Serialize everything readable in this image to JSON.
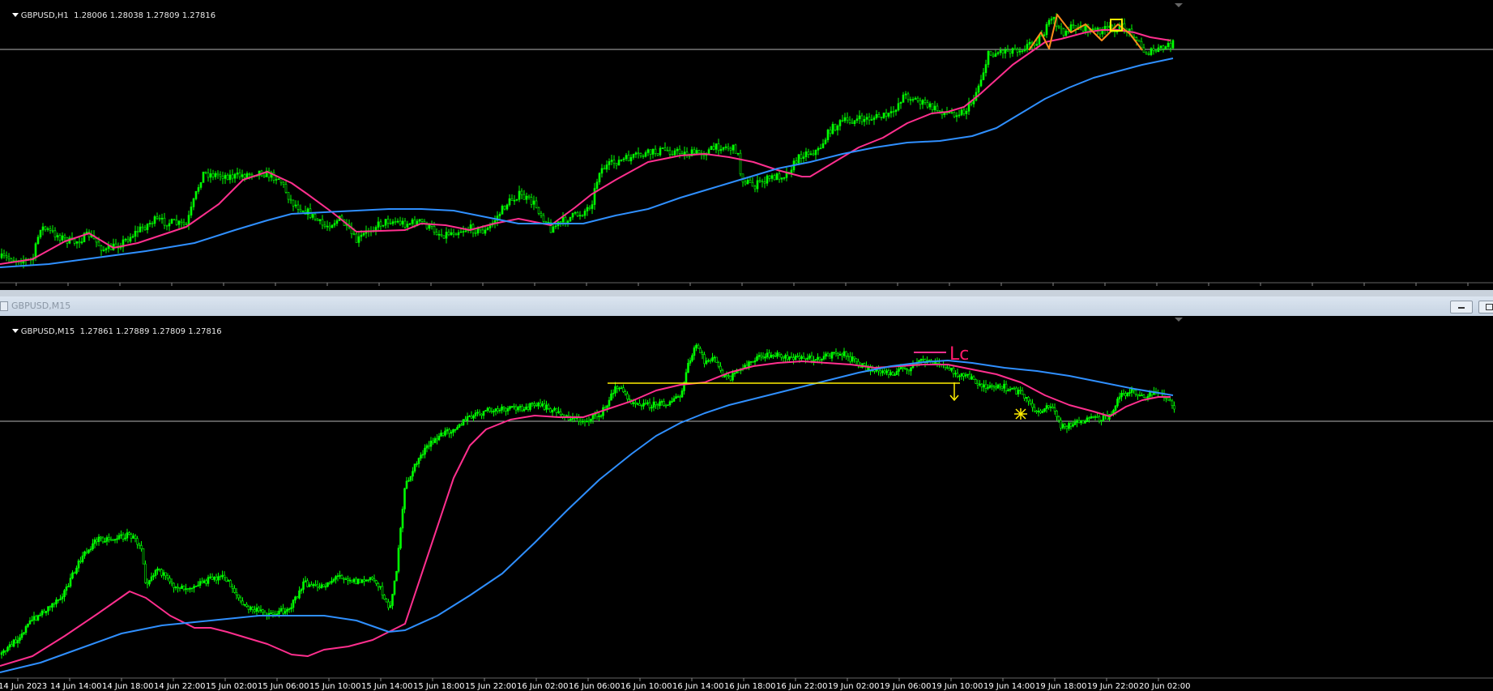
{
  "top_chart": {
    "symbol_tf": "GBPUSD,H1",
    "ohlc": "1.28006 1.28038 1.27809 1.27816",
    "time_labels": []
  },
  "bottom_window": {
    "title": "GBPUSD,M15"
  },
  "bottom_chart": {
    "symbol_tf": "GBPUSD,M15",
    "ohlc": "1.27861 1.27889 1.27809 1.27816",
    "time_labels": [
      "14 Jun 2023",
      "14 Jun 14:00",
      "14 Jun 18:00",
      "14 Jun 22:00",
      "15 Jun 02:00",
      "15 Jun 06:00",
      "15 Jun 10:00",
      "15 Jun 14:00",
      "15 Jun 18:00",
      "15 Jun 22:00",
      "16 Jun 02:00",
      "16 Jun 06:00",
      "16 Jun 10:00",
      "16 Jun 14:00",
      "16 Jun 18:00",
      "16 Jun 22:00",
      "19 Jun 02:00",
      "19 Jun 06:00",
      "19 Jun 10:00",
      "19 Jun 14:00",
      "19 Jun 18:00",
      "19 Jun 22:00",
      "20 Jun 02:00"
    ],
    "annotation": "Lc"
  },
  "colors": {
    "candle": "#00ff00",
    "fast_ma": "#ff2f8e",
    "slow_ma": "#2f8fff",
    "hline": "#b4b4b4",
    "zigzag": "#ff8c1a",
    "highlight": "#ffee00"
  },
  "icons": [
    "dropdown-triangle-icon",
    "window-icon",
    "minimize-icon",
    "restore-icon",
    "arrow-down-icon",
    "star-marker-icon"
  ]
}
